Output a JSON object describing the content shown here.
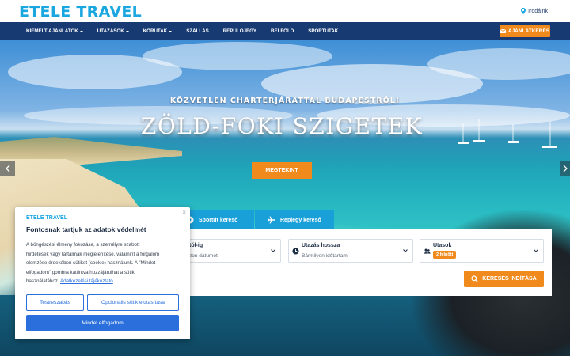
{
  "brand": {
    "logo_text": "ETELE TRAVEL",
    "offices_label": "Irodáink"
  },
  "nav": {
    "items": [
      {
        "label": "KIEMELT AJÁNLATOK",
        "dropdown": true
      },
      {
        "label": "UTAZÁSOK",
        "dropdown": true
      },
      {
        "label": "KÖRUTAK",
        "dropdown": true
      },
      {
        "label": "SZÁLLÁS",
        "dropdown": false
      },
      {
        "label": "REPÜLŐJEGY",
        "dropdown": false
      },
      {
        "label": "BELFÖLD",
        "dropdown": false
      },
      {
        "label": "SPORTUTAK",
        "dropdown": false
      }
    ],
    "quote_button": "AJÁNLATKÉRÉS"
  },
  "hero": {
    "subtitle": "KÖZVETLEN CHARTERJÁRATTAL BUDAPESTRŐL!",
    "title": "ZÖLD-FOKI SZIGETEK",
    "cta": "MEGTEKINT"
  },
  "search": {
    "tabs": [
      {
        "label": "Sportút kereső",
        "icon": "soccer-ball-icon"
      },
      {
        "label": "Repjegy kereső",
        "icon": "plane-icon"
      }
    ],
    "fields": {
      "dates": {
        "label": "tól-ig",
        "value": "zon dátumot"
      },
      "duration": {
        "label": "Utazás hossza",
        "value": "Bármilyen időtartam"
      },
      "travelers": {
        "label": "Utasok",
        "value": "2 felnőtt"
      }
    },
    "submit": "KERESÉS INDÍTÁSA"
  },
  "cookie": {
    "brand": "ETELE TRAVEL",
    "title": "Fontosnak tartjuk az adatok védelmét",
    "body_line1": "A böngészési élmény fokozása, a személyre szabott",
    "body_line2": "hirdetések vagy tartalmak megjelenítése, valamint a forgalom",
    "body_line3": "elemzése érdekében sütiket (cookie) használunk. A \"Mindet",
    "body_line4": "elfogadom\" gombra kattintva hozzájárulhat a sütik",
    "body_line5_prefix": "használatához.",
    "policy_link": "Adatkezelési tájékoztató",
    "customize": "Testreszabás",
    "reject_optional": "Opcionális sütik elutasítása",
    "accept_all": "Mindet elfogadom",
    "close": "×"
  },
  "colors": {
    "brand_blue": "#1aa7e0",
    "nav_navy": "#173a72",
    "accent_orange": "#f08a1c",
    "link_blue": "#2a6fdb"
  }
}
